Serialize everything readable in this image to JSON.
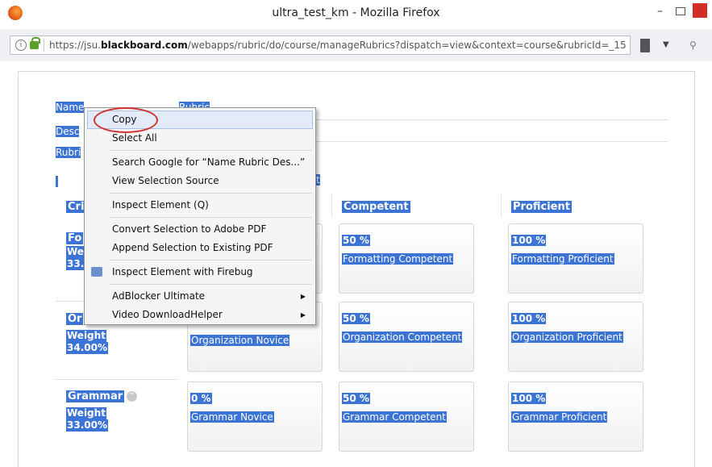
{
  "window": {
    "title": "ultra_test_km - Mozilla Firefox"
  },
  "address_bar": {
    "url_prefix": "https://jsu.",
    "url_domain": "blackboard.com",
    "url_rest": "/webapps/rubric/do/course/manageRubrics?dispatch=view&context=course&rubricId=_15708_1"
  },
  "rubric": {
    "name_label": "Name",
    "rubric_label_partial": "Rubric",
    "desc_label_partial": "Desc",
    "type_label_partial": "Rubri",
    "sel_fragment": "t",
    "headers": {
      "criteria_partial": "Cri",
      "competent": "Competent",
      "proficient": "Proficient"
    },
    "rows": [
      {
        "name_partial": "Fo",
        "weight_label_partial": "We",
        "weight_value_partial": "33.",
        "competent_pct": "50 %",
        "competent_desc": "Formatting Competent",
        "proficient_pct": "100 %",
        "proficient_desc": "Formatting Proficient"
      },
      {
        "name_partial": "Or",
        "weight_label": "Weight",
        "weight_value": "34.00%",
        "novice_desc": "Organization Novice",
        "competent_pct": "50 %",
        "competent_desc": "Organization Competent",
        "proficient_pct": "100 %",
        "proficient_desc": "Organization Proficient"
      },
      {
        "name": "Grammar",
        "weight_label": "Weight",
        "weight_value": "33.00%",
        "novice_pct": "0 %",
        "novice_desc": "Grammar Novice",
        "competent_pct": "50 %",
        "competent_desc": "Grammar Competent",
        "proficient_pct": "100 %",
        "proficient_desc": "Grammar Proficient"
      }
    ]
  },
  "context_menu": {
    "copy": "Copy",
    "select_all": "Select All",
    "search_google": "Search Google for “Name Rubric Des...”",
    "view_selection_source": "View Selection Source",
    "inspect_element": "Inspect Element (Q)",
    "convert_pdf": "Convert Selection to Adobe PDF",
    "append_pdf": "Append Selection to Existing PDF",
    "inspect_firebug": "Inspect Element with Firebug",
    "adblocker": "AdBlocker Ultimate",
    "video_downloader": "Video DownloadHelper"
  },
  "colors": {
    "selection": "#3b74d4",
    "annotation_circle": "#d23333"
  }
}
